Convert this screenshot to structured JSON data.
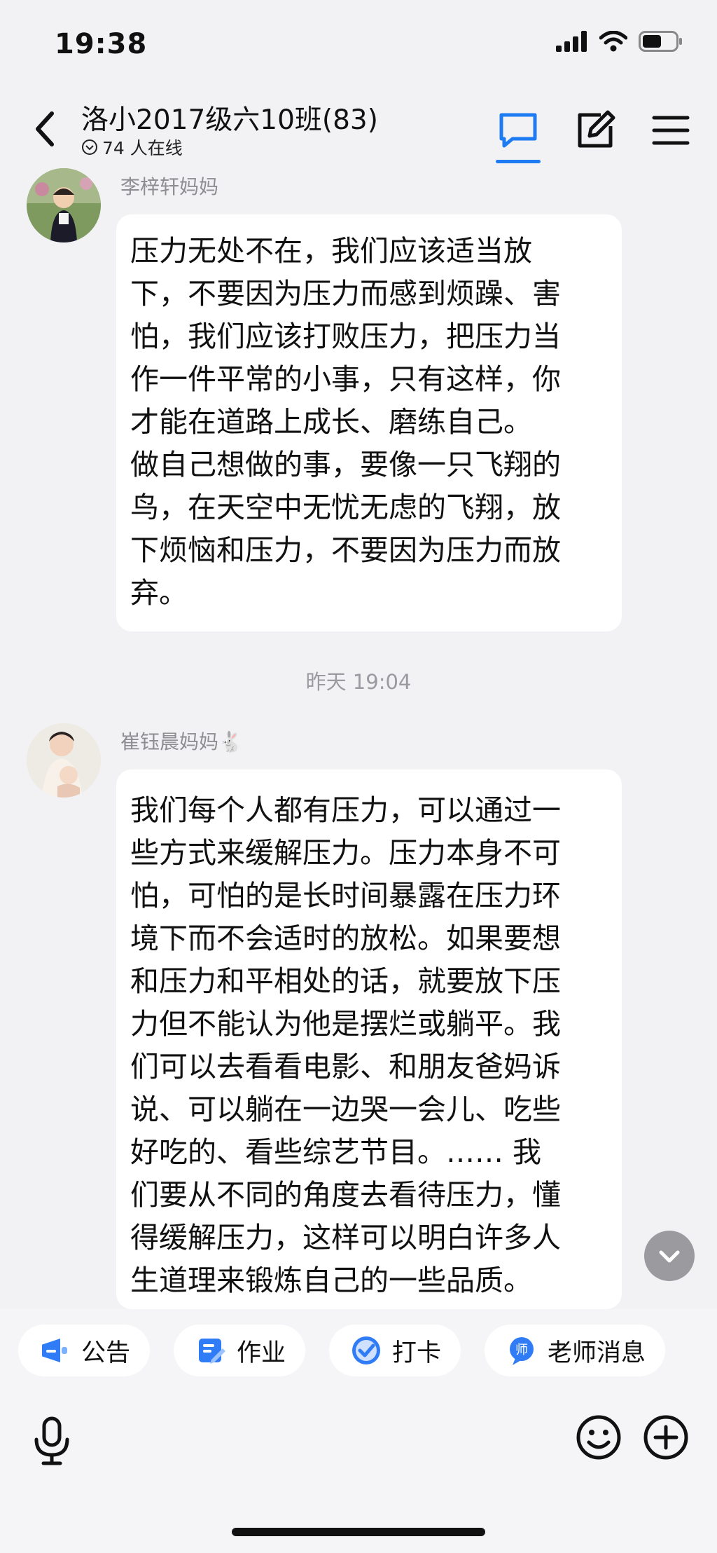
{
  "status_bar": {
    "time": "19:38"
  },
  "header": {
    "title": "洛小2017级六10班(83)",
    "online": "74 人在线"
  },
  "messages": [
    {
      "sender": "李梓轩妈妈",
      "lines": [
        "压力无处不在，我们应该适当放",
        "下，不要因为压力而感到烦躁、害",
        "怕，我们应该打败压力，把压力当",
        "作一件平常的小事，只有这样，你",
        "才能在道路上成长、磨练自己。",
        "做自己想做的事，要像一只飞翔的",
        "鸟，在天空中无忧无虑的飞翔，放",
        "下烦恼和压力，不要因为压力而放",
        "弃。"
      ]
    },
    {
      "sender": "崔钰晨妈妈🐇",
      "lines": [
        "我们每个人都有压力，可以通过一",
        "些方式来缓解压力。压力本身不可",
        "怕，可怕的是长时间暴露在压力环",
        "境下而不会适时的放松。如果要想",
        "和压力和平相处的话，就要放下压",
        "力但不能认为他是摆烂或躺平。我",
        "们可以去看看电影、和朋友爸妈诉",
        "说、可以躺在一边哭一会儿、吃些",
        "好吃的、看些综艺节目。…… 我",
        "们要从不同的角度去看待压力，懂",
        "得缓解压力，这样可以明白许多人",
        "生道理来锻炼自己的一些品质。"
      ]
    }
  ],
  "timestamp": "昨天 19:04",
  "quick_actions": [
    {
      "label": "公告",
      "icon": "announcement-icon",
      "color": "#2f7cf6"
    },
    {
      "label": "作业",
      "icon": "homework-icon",
      "color": "#2f7cf6"
    },
    {
      "label": "打卡",
      "icon": "checkin-icon",
      "color": "#2f7cf6"
    },
    {
      "label": "老师消息",
      "icon": "teacher-message-icon",
      "color": "#2f7cf6"
    }
  ],
  "theme": {
    "accent": "#1e7bf2"
  }
}
